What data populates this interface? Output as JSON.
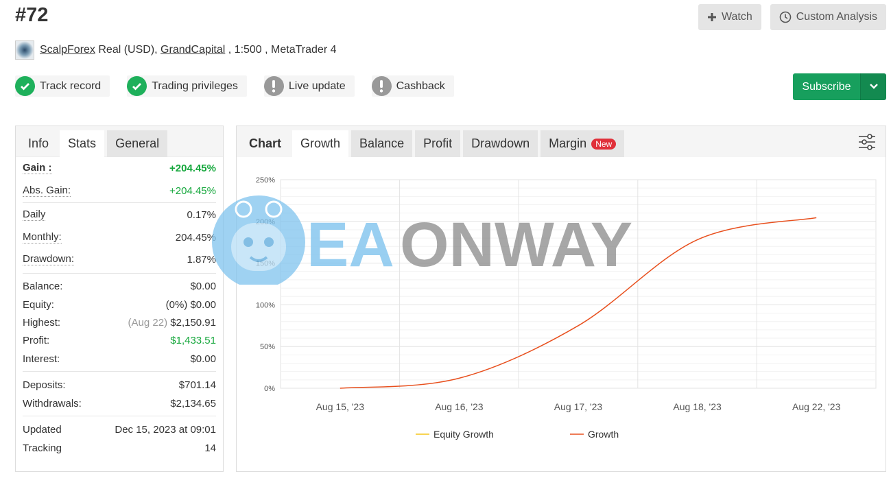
{
  "header": {
    "title": "#72"
  },
  "actions": {
    "watch_label": "Watch",
    "custom_label": "Custom Analysis"
  },
  "meta": {
    "owner": "ScalpForex",
    "account_type": " Real (USD), ",
    "broker": "GrandCapital",
    "leverage_platform": " , 1:500 , MetaTrader 4"
  },
  "badges": [
    {
      "label": "Track record",
      "status": "ok"
    },
    {
      "label": "Trading privileges",
      "status": "ok"
    },
    {
      "label": "Live update",
      "status": "warn"
    },
    {
      "label": "Cashback",
      "status": "warn"
    }
  ],
  "subscribe": {
    "label": "Subscribe"
  },
  "left_tabs": {
    "info": "Info",
    "stats": "Stats",
    "general": "General"
  },
  "stats": {
    "gain_label": "Gain :",
    "gain_value": "+204.45%",
    "abs_gain_label": "Abs. Gain:",
    "abs_gain_value": "+204.45%",
    "daily_label": "Daily",
    "daily_value": "0.17%",
    "monthly_label": "Monthly:",
    "monthly_value": "204.45%",
    "drawdown_label": "Drawdown:",
    "drawdown_value": "1.87%",
    "balance_label": "Balance:",
    "balance_value": "$0.00",
    "equity_label": "Equity:",
    "equity_value": "(0%) $0.00",
    "highest_label": "Highest:",
    "highest_date": "(Aug 22)",
    "highest_value": "$2,150.91",
    "profit_label": "Profit:",
    "profit_value": "$1,433.51",
    "interest_label": "Interest:",
    "interest_value": "$0.00",
    "deposits_label": "Deposits:",
    "deposits_value": "$701.14",
    "withdrawals_label": "Withdrawals:",
    "withdrawals_value": "$2,134.65",
    "updated_label": "Updated",
    "updated_value": "Dec 15, 2023 at 09:01",
    "tracking_label": "Tracking",
    "tracking_value": "14"
  },
  "chart_tabs": {
    "chart": "Chart",
    "growth": "Growth",
    "balance": "Balance",
    "profit": "Profit",
    "drawdown": "Drawdown",
    "margin": "Margin",
    "new_badge": "New"
  },
  "watermark": {
    "text_a": "EA",
    "text_b": "ONWAY"
  },
  "colors": {
    "growth": "#e8501e",
    "equity": "#f5c518",
    "green": "#15a73c",
    "subscribe": "#179f5d"
  },
  "chart_data": {
    "type": "line",
    "x": [
      "Aug 15, '23",
      "Aug 16, '23",
      "Aug 17, '23",
      "Aug 18, '23",
      "Aug 22, '23"
    ],
    "xlabel": "",
    "ylabel": "",
    "ylim": [
      0,
      250
    ],
    "yticks": [
      "0%",
      "50%",
      "100%",
      "150%",
      "200%",
      "250%"
    ],
    "grid": true,
    "legend": "bottom",
    "series": [
      {
        "name": "Equity Growth",
        "values": []
      },
      {
        "name": "Growth",
        "values": [
          0,
          12,
          75,
          178,
          204.45
        ]
      }
    ]
  }
}
